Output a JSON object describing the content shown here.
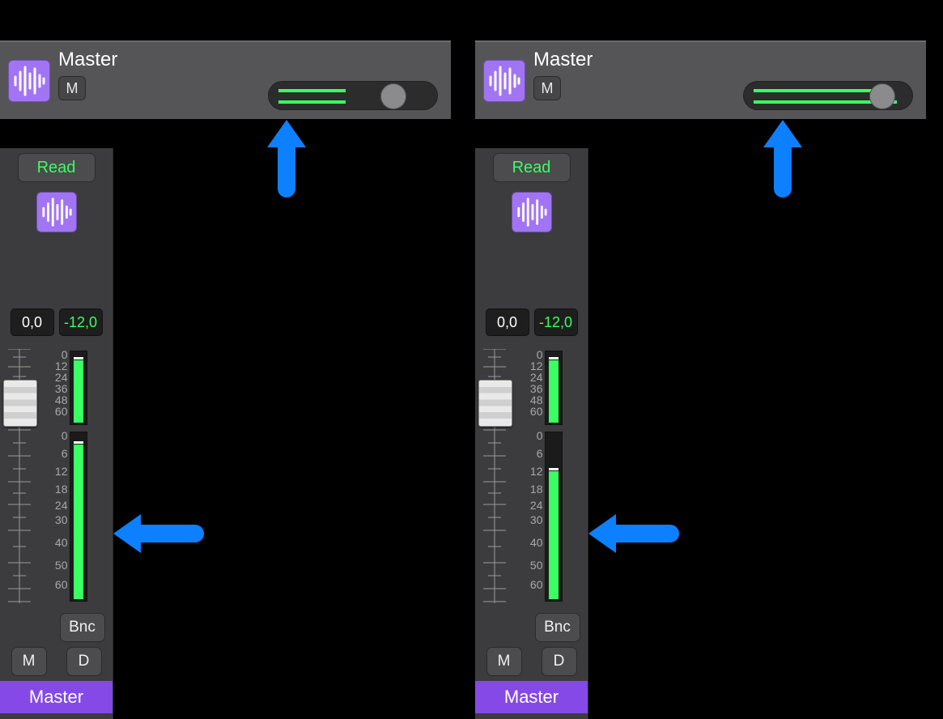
{
  "icon_color": "#a174f4",
  "accent_green": "#3aff62",
  "arrow_color": "#0d80ff",
  "panels": [
    {
      "header": {
        "title": "Master",
        "mute_label": "M",
        "volume_fill_pct": 45,
        "knob_pct": 74
      },
      "strip": {
        "read_label": "Read",
        "pan_value": "0,0",
        "gain_value": "-12,0",
        "meter1_ticks": [
          "0",
          "12",
          "24",
          "36",
          "48",
          "60"
        ],
        "meter2_ticks": [
          "0",
          "6",
          "12",
          "18",
          "24",
          "30",
          "40",
          "50",
          "60"
        ],
        "meter1_fill_pct": 86,
        "meter2_fill_pct": 92,
        "bnc_label": "Bnc",
        "mute_label": "M",
        "dim_label": "D",
        "name": "Master"
      }
    },
    {
      "header": {
        "title": "Master",
        "mute_label": "M",
        "volume_fill_pct": 90,
        "knob_pct": 82
      },
      "strip": {
        "read_label": "Read",
        "pan_value": "0,0",
        "gain_value": "-12,0",
        "meter1_ticks": [
          "0",
          "12",
          "24",
          "36",
          "48",
          "60"
        ],
        "meter2_ticks": [
          "0",
          "6",
          "12",
          "18",
          "24",
          "30",
          "40",
          "50",
          "60"
        ],
        "meter1_fill_pct": 86,
        "meter2_fill_pct": 76,
        "bnc_label": "Bnc",
        "mute_label": "M",
        "dim_label": "D",
        "name": "Master"
      }
    }
  ]
}
